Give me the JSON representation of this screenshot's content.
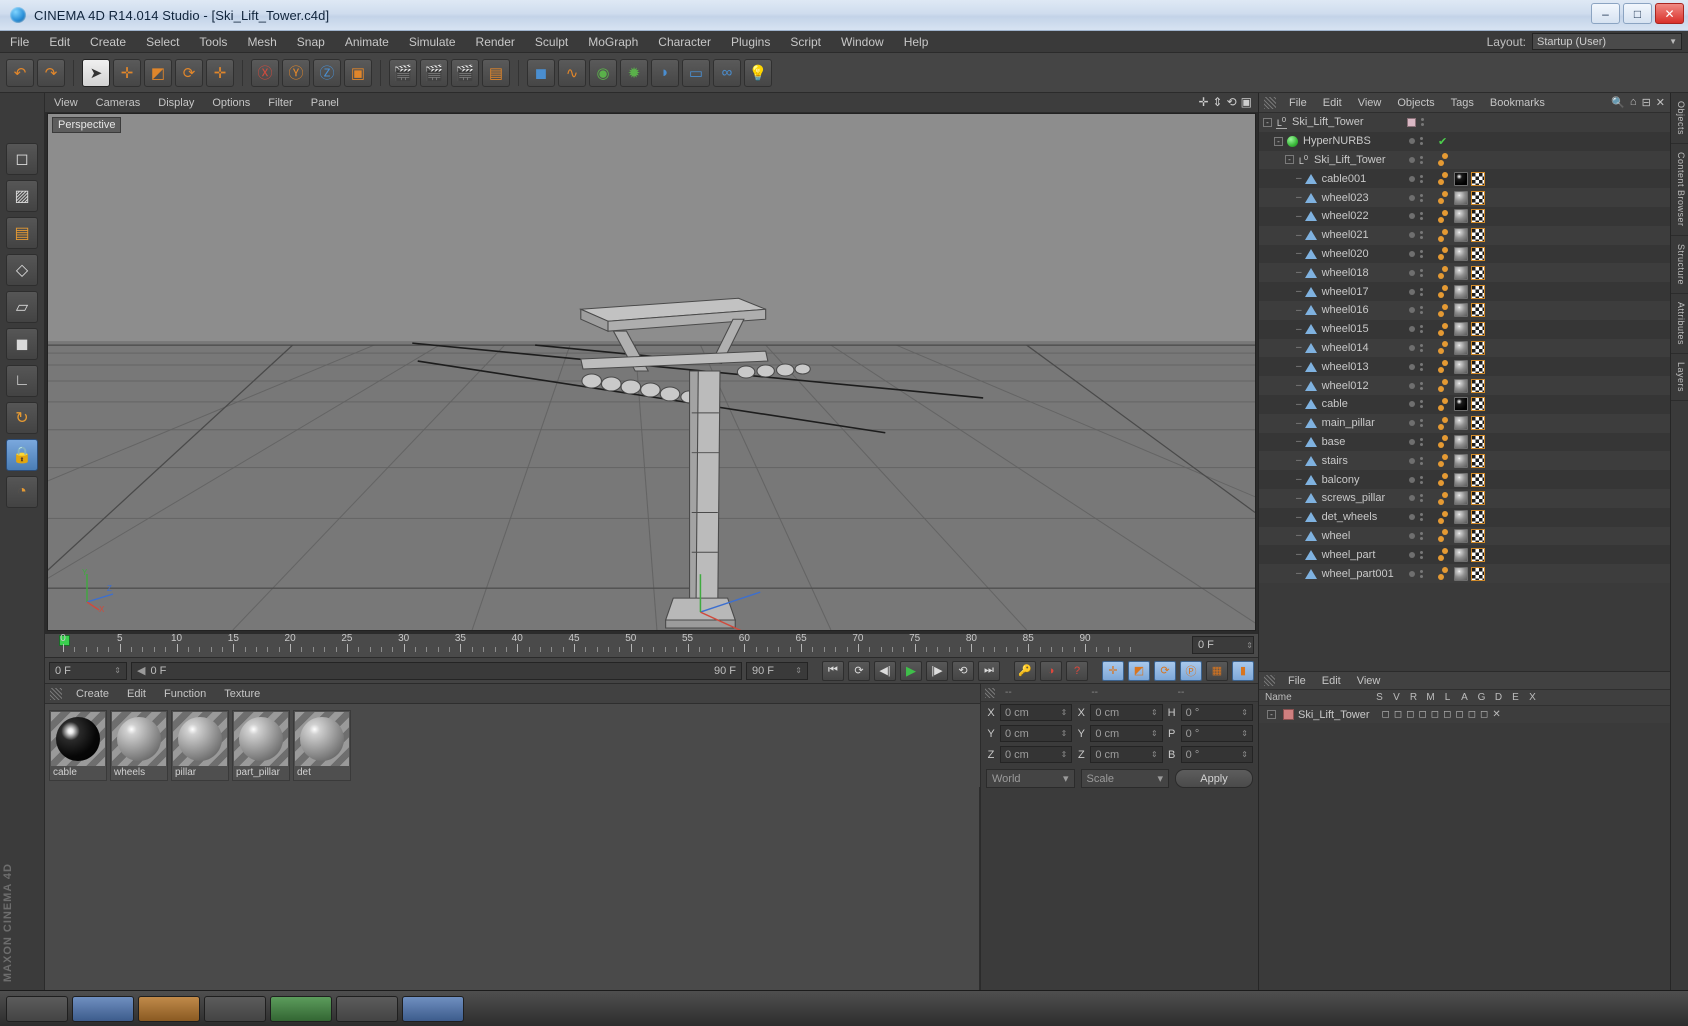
{
  "window": {
    "title": "CINEMA 4D R14.014 Studio - [Ski_Lift_Tower.c4d]",
    "app_icon": "c4d-logo-icon",
    "minimize": "–",
    "maximize": "□",
    "close": "✕"
  },
  "menubar": {
    "items": [
      "File",
      "Edit",
      "Create",
      "Select",
      "Tools",
      "Mesh",
      "Snap",
      "Animate",
      "Simulate",
      "Render",
      "Sculpt",
      "MoGraph",
      "Character",
      "Plugins",
      "Script",
      "Window",
      "Help"
    ],
    "layout_label": "Layout:",
    "layout_value": "Startup (User)"
  },
  "toolbar": {
    "buttons": [
      {
        "name": "undo-button",
        "glyph": "↶"
      },
      {
        "name": "redo-button",
        "glyph": "↷"
      },
      {
        "name": "live-selection-tool",
        "glyph": "➤",
        "active": true
      },
      {
        "name": "move-tool",
        "glyph": "✛",
        "accent": "orange"
      },
      {
        "name": "scale-tool",
        "glyph": "◩",
        "accent": "orange"
      },
      {
        "name": "rotate-tool",
        "glyph": "⟳",
        "accent": "orange"
      },
      {
        "name": "add-tool",
        "glyph": "✛",
        "accent": "orange"
      },
      {
        "name": "lock-x-axis",
        "glyph": "X",
        "accent": "red"
      },
      {
        "name": "lock-y-axis",
        "glyph": "Y",
        "accent": "green"
      },
      {
        "name": "lock-z-axis",
        "glyph": "Z",
        "accent": "blue"
      },
      {
        "name": "world-coordinates",
        "glyph": "▣",
        "accent": "orange"
      },
      {
        "name": "render-view-button",
        "glyph": "▶",
        "accent": "blue"
      },
      {
        "name": "render-region-button",
        "glyph": "▶",
        "accent": "blue"
      },
      {
        "name": "render-settings-button",
        "glyph": "▶",
        "accent": "blue"
      },
      {
        "name": "cube-primitive-button",
        "glyph": "◼",
        "accent": "blue"
      },
      {
        "name": "spline-button",
        "glyph": "∿",
        "accent": "orange"
      },
      {
        "name": "nurbs-button",
        "glyph": "◉",
        "accent": "green"
      },
      {
        "name": "array-button",
        "glyph": "✹",
        "accent": "green"
      },
      {
        "name": "deformer-button",
        "glyph": "◗",
        "accent": "blue"
      },
      {
        "name": "camera-button",
        "glyph": "▭",
        "accent": "blue"
      },
      {
        "name": "environment-button",
        "glyph": "∞",
        "accent": "blue"
      },
      {
        "name": "light-button",
        "glyph": "♦",
        "accent": "yellow"
      }
    ]
  },
  "left_toolbar": {
    "tools": [
      {
        "name": "model-mode-tool",
        "glyph": "◻"
      },
      {
        "name": "texture-mode-tool",
        "glyph": "▨"
      },
      {
        "name": "polygon-mode-tool",
        "glyph": "◤"
      },
      {
        "name": "points-mode-tool",
        "glyph": "◇"
      },
      {
        "name": "edges-mode-tool",
        "glyph": "◻"
      },
      {
        "name": "polygons-select-tool",
        "glyph": "◼"
      },
      {
        "name": "workplane-tool",
        "glyph": "∟"
      },
      {
        "name": "move-axis-tool",
        "glyph": "↻"
      },
      {
        "name": "lock-axis-tool",
        "glyph": "🔒",
        "selected": true
      },
      {
        "name": "enable-axis-tool",
        "glyph": "◔"
      }
    ]
  },
  "viewport": {
    "menu": [
      "View",
      "Cameras",
      "Display",
      "Options",
      "Filter",
      "Panel"
    ],
    "label": "Perspective",
    "corner_icons": [
      "pan-icon",
      "dolly-icon",
      "rotate-icon",
      "maximize-icon"
    ],
    "axis_labels": {
      "y": "Y",
      "x": "X",
      "z": "Z"
    }
  },
  "timeline": {
    "ticks": [
      0,
      5,
      10,
      15,
      20,
      25,
      30,
      35,
      40,
      45,
      50,
      55,
      60,
      65,
      70,
      75,
      80,
      85,
      90
    ],
    "end_field": "0 F",
    "current_frame": "0 F",
    "start_field": "0 F",
    "range_end": "90 F",
    "range_total": "90 F"
  },
  "playback": {
    "buttons": [
      {
        "name": "goto-start-button",
        "glyph": "⏮"
      },
      {
        "name": "loop-button",
        "glyph": "⟳"
      },
      {
        "name": "step-back-button",
        "glyph": "◀"
      },
      {
        "name": "play-button",
        "glyph": "▶"
      },
      {
        "name": "step-forward-button",
        "glyph": "▶"
      },
      {
        "name": "playback-reverse-button",
        "glyph": "⟲"
      },
      {
        "name": "goto-end-button",
        "glyph": "⏭"
      },
      {
        "name": "record-key-button",
        "glyph": "⬤"
      },
      {
        "name": "autokey-button",
        "glyph": "◑"
      },
      {
        "name": "keyframe-help-button",
        "glyph": "?"
      },
      {
        "name": "record-position-button",
        "glyph": "✛"
      },
      {
        "name": "record-scale-button",
        "glyph": "◩"
      },
      {
        "name": "record-rotation-button",
        "glyph": "⟳"
      },
      {
        "name": "record-param-button",
        "glyph": "P"
      },
      {
        "name": "point-level-anim-button",
        "glyph": "▦"
      },
      {
        "name": "keyframe-selection-button",
        "glyph": "▮"
      }
    ]
  },
  "material_manager": {
    "menu": [
      "Create",
      "Edit",
      "Function",
      "Texture"
    ],
    "materials": [
      {
        "name": "cable",
        "preview": "black"
      },
      {
        "name": "wheels",
        "preview": "grey"
      },
      {
        "name": "pillar",
        "preview": "grey"
      },
      {
        "name": "part_pillar",
        "preview": "grey"
      },
      {
        "name": "det",
        "preview": "grey"
      }
    ]
  },
  "coordinates": {
    "headers": [
      "--",
      "--",
      "--"
    ],
    "rows": [
      {
        "axis": "X",
        "position": "0 cm",
        "axis2": "X",
        "size": "0 cm",
        "axis3": "H",
        "rotation": "0 °"
      },
      {
        "axis": "Y",
        "position": "0 cm",
        "axis2": "Y",
        "size": "0 cm",
        "axis3": "P",
        "rotation": "0 °"
      },
      {
        "axis": "Z",
        "position": "0 cm",
        "axis2": "Z",
        "size": "0 cm",
        "axis3": "B",
        "rotation": "0 °"
      }
    ],
    "coord_system": "World",
    "size_mode": "Scale",
    "apply_label": "Apply"
  },
  "object_manager": {
    "menu": [
      "File",
      "Edit",
      "View",
      "Objects",
      "Tags",
      "Bookmarks"
    ],
    "header_icons": [
      "search-icon",
      "home-icon",
      "collapse-icon",
      "close-icon"
    ],
    "objects": [
      {
        "name": "Ski_Lift_Tower",
        "icon": "null-object-icon",
        "depth": 0,
        "expandable": true,
        "dot": "pink"
      },
      {
        "name": "HyperNURBS",
        "icon": "hypernurbs-icon",
        "depth": 1,
        "expandable": true,
        "check": true
      },
      {
        "name": "Ski_Lift_Tower",
        "icon": "null-object-icon",
        "depth": 2,
        "expandable": true,
        "tags": [
          "dots"
        ]
      },
      {
        "name": "cable001",
        "icon": "polygon-object-icon",
        "depth": 3,
        "tags": [
          "dots",
          "mat-black",
          "uv"
        ]
      },
      {
        "name": "wheel023",
        "icon": "polygon-object-icon",
        "depth": 3,
        "tags": [
          "dots",
          "mat-grey",
          "uv"
        ]
      },
      {
        "name": "wheel022",
        "icon": "polygon-object-icon",
        "depth": 3,
        "tags": [
          "dots",
          "mat-grey",
          "uv"
        ]
      },
      {
        "name": "wheel021",
        "icon": "polygon-object-icon",
        "depth": 3,
        "tags": [
          "dots",
          "mat-grey",
          "uv"
        ]
      },
      {
        "name": "wheel020",
        "icon": "polygon-object-icon",
        "depth": 3,
        "tags": [
          "dots",
          "mat-grey",
          "uv"
        ]
      },
      {
        "name": "wheel018",
        "icon": "polygon-object-icon",
        "depth": 3,
        "tags": [
          "dots",
          "mat-grey",
          "uv"
        ]
      },
      {
        "name": "wheel017",
        "icon": "polygon-object-icon",
        "depth": 3,
        "tags": [
          "dots",
          "mat-grey",
          "uv"
        ]
      },
      {
        "name": "wheel016",
        "icon": "polygon-object-icon",
        "depth": 3,
        "tags": [
          "dots",
          "mat-grey",
          "uv"
        ]
      },
      {
        "name": "wheel015",
        "icon": "polygon-object-icon",
        "depth": 3,
        "tags": [
          "dots",
          "mat-grey",
          "uv"
        ]
      },
      {
        "name": "wheel014",
        "icon": "polygon-object-icon",
        "depth": 3,
        "tags": [
          "dots",
          "mat-grey",
          "uv"
        ]
      },
      {
        "name": "wheel013",
        "icon": "polygon-object-icon",
        "depth": 3,
        "tags": [
          "dots",
          "mat-grey",
          "uv"
        ]
      },
      {
        "name": "wheel012",
        "icon": "polygon-object-icon",
        "depth": 3,
        "tags": [
          "dots",
          "mat-grey",
          "uv"
        ]
      },
      {
        "name": "cable",
        "icon": "polygon-object-icon",
        "depth": 3,
        "tags": [
          "dots",
          "mat-black",
          "uv"
        ]
      },
      {
        "name": "main_pillar",
        "icon": "polygon-object-icon",
        "depth": 3,
        "tags": [
          "dots",
          "mat-grey",
          "uv"
        ]
      },
      {
        "name": "base",
        "icon": "polygon-object-icon",
        "depth": 3,
        "tags": [
          "dots",
          "mat-grey",
          "uv"
        ]
      },
      {
        "name": "stairs",
        "icon": "polygon-object-icon",
        "depth": 3,
        "tags": [
          "dots",
          "mat-grey",
          "uv"
        ]
      },
      {
        "name": "balcony",
        "icon": "polygon-object-icon",
        "depth": 3,
        "tags": [
          "dots",
          "mat-grey",
          "uv"
        ]
      },
      {
        "name": "screws_pillar",
        "icon": "polygon-object-icon",
        "depth": 3,
        "tags": [
          "dots",
          "mat-grey",
          "uv"
        ]
      },
      {
        "name": "det_wheels",
        "icon": "polygon-object-icon",
        "depth": 3,
        "tags": [
          "dots",
          "mat-grey",
          "uv"
        ]
      },
      {
        "name": "wheel",
        "icon": "polygon-object-icon",
        "depth": 3,
        "tags": [
          "dots",
          "mat-grey",
          "uv"
        ]
      },
      {
        "name": "wheel_part",
        "icon": "polygon-object-icon",
        "depth": 3,
        "tags": [
          "dots",
          "mat-grey",
          "uv"
        ]
      },
      {
        "name": "wheel_part001",
        "icon": "polygon-object-icon",
        "depth": 3,
        "tags": [
          "dots",
          "mat-grey",
          "uv"
        ]
      }
    ]
  },
  "attribute_panel": {
    "menu": [
      "File",
      "Edit",
      "View"
    ],
    "layer_columns": [
      "Name",
      "S",
      "V",
      "R",
      "M",
      "L",
      "A",
      "G",
      "D",
      "E",
      "X"
    ],
    "layer_row": "Ski_Lift_Tower"
  },
  "side_tabs": [
    "Objects",
    "Content Browser",
    "Structure",
    "Attributes",
    "Layers"
  ],
  "branding": "MAXON CINEMA 4D",
  "colors": {
    "accent_orange": "#e59a33",
    "selection_blue": "#7aa8d8",
    "panel_bg": "#3a3a3a",
    "toolbar_bg": "#454545",
    "viewport_sky": "#8f8f8f",
    "viewport_ground": "#6e6e6e",
    "green_check": "#4ccf4c"
  }
}
